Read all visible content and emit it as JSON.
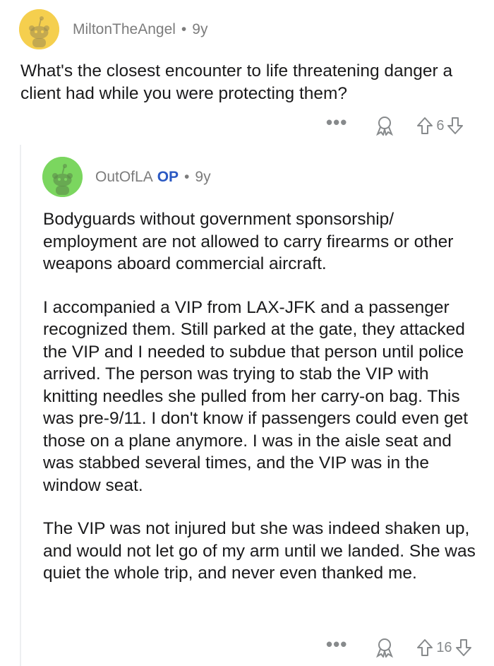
{
  "parent_comment": {
    "username": "MiltonTheAngel",
    "separator": "•",
    "age": "9y",
    "body": "What's the closest encounter to life threatening danger a client had while you were protecting them?",
    "score": "6",
    "more_label": "•••"
  },
  "reply_comment": {
    "username": "OutOfLA",
    "op_badge": "OP",
    "separator": "•",
    "age": "9y",
    "paragraphs": [
      "Bodyguards without government sponsorship/ employment are not allowed to carry firearms or other weapons aboard commercial aircraft.",
      "I accompanied a VIP from LAX-JFK and a passenger recognized them. Still parked at the gate, they attacked the VIP and I needed to subdue that person until police arrived. The person was trying to stab the VIP with knitting needles she pulled from her carry-on bag. This was pre-9/11. I don't know if passengers could even get those on a plane anymore. I was in the aisle seat and was stabbed several times, and the VIP was in the window seat.",
      "The VIP was not injured but she was indeed shaken up, and would not let go of my arm until we landed. She was quiet the whole trip, and never even thanked me."
    ],
    "score": "16",
    "more_label": "•••"
  },
  "colors": {
    "parent_avatar_bg": "#f5cf4e",
    "reply_avatar_bg": "#7bd65f",
    "op_badge": "#2b59c3",
    "meta_text": "#7c7c7c",
    "icon": "#878a8c"
  },
  "icons": [
    "snoo-avatar-icon",
    "award-icon",
    "upvote-arrow-icon",
    "downvote-arrow-icon",
    "more-options-icon"
  ]
}
